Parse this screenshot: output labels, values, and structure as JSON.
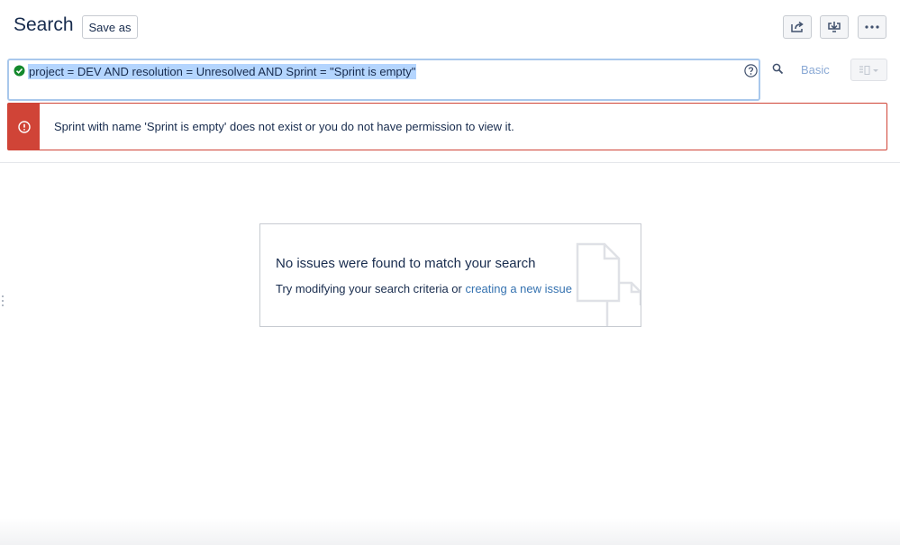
{
  "header": {
    "title": "Search",
    "save_as_label": "Save as",
    "share_icon": "share-icon",
    "export_icon": "export-icon",
    "more_icon": "more-icon"
  },
  "search": {
    "jql_query": "project = DEV AND resolution = Unresolved AND Sprint = \"Sprint is empty\"",
    "valid_icon": "check-circle-icon",
    "help_icon": "question-circle-icon",
    "search_icon": "magnifier-icon",
    "basic_label": "Basic",
    "layout_icon": "layout-switcher-icon"
  },
  "error": {
    "icon": "exclamation-circle-icon",
    "message": "Sprint with name 'Sprint is empty' does not exist or you do not have permission to view it."
  },
  "empty_state": {
    "title": "No issues were found to match your search",
    "description_prefix": "Try modifying your search criteria or ",
    "create_link": "creating a new issue",
    "graphic": "document-icon"
  },
  "colors": {
    "error_red": "#d04437",
    "link_blue": "#3572b0",
    "success_green": "#14892c",
    "selection": "#b4d5fe"
  }
}
